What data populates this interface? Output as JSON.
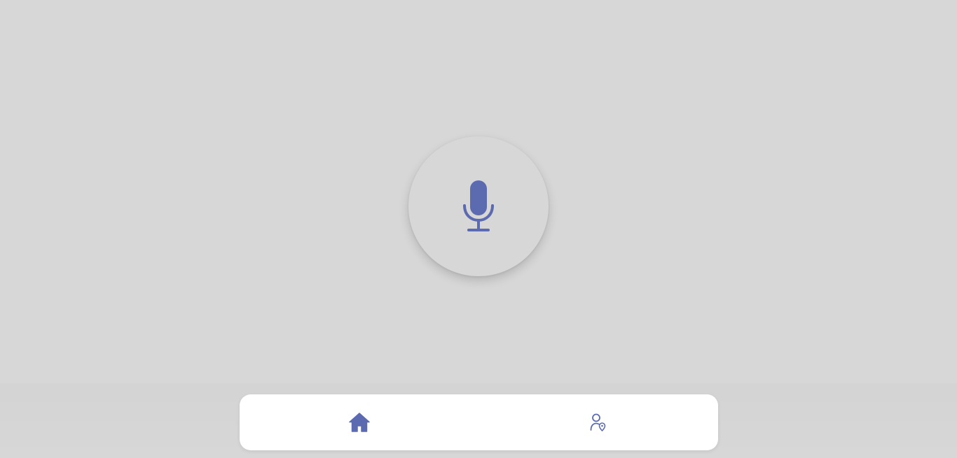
{
  "colors": {
    "background": "#d7d7d7",
    "accent": "#5c6bb0",
    "nav_background": "#ffffff"
  },
  "mic_button": {
    "icon": "microphone-icon"
  },
  "bottom_nav": {
    "items": [
      {
        "id": "home",
        "icon": "home-icon",
        "active": true
      },
      {
        "id": "profile-location",
        "icon": "user-location-icon",
        "active": false
      }
    ]
  }
}
